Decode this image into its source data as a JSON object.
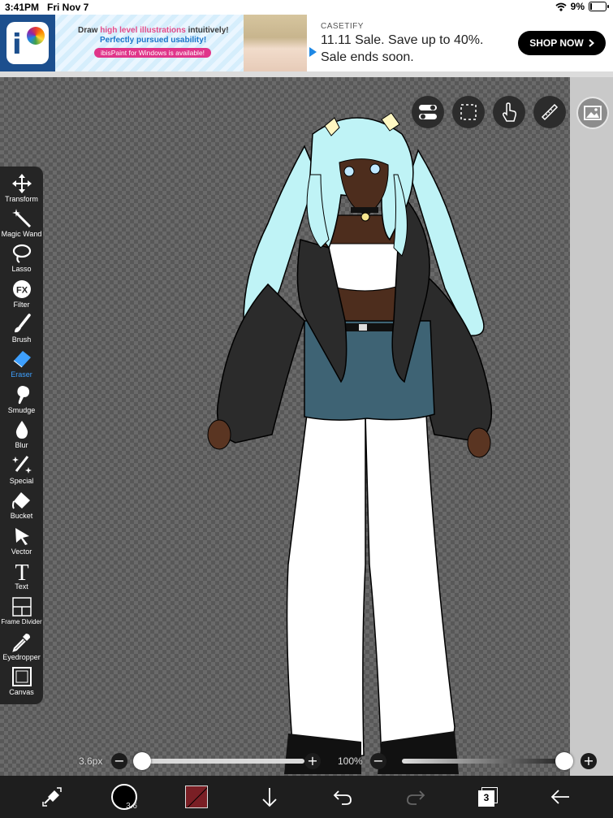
{
  "status_bar": {
    "time": "3:41PM",
    "date": "Fri Nov 7",
    "battery": "9%"
  },
  "ad": {
    "left_banner": {
      "line1_pre": "Draw ",
      "line1_highlight": "high level illustrations",
      "line1_post": " intuitively!",
      "line2": "Perfectly pursued usability!",
      "pill": "ibisPaint for Windows is available!"
    },
    "brand": "CASETIFY",
    "headline_1": "11.11 Sale. Save up to 40%.",
    "headline_2": "Sale ends soon.",
    "cta": "SHOP NOW"
  },
  "tools": [
    {
      "label": "Transform",
      "icon": "move-arrows-icon",
      "active": false
    },
    {
      "label": "Magic Wand",
      "icon": "magic-wand-icon",
      "active": false
    },
    {
      "label": "Lasso",
      "icon": "lasso-icon",
      "active": false
    },
    {
      "label": "Filter",
      "icon": "fx-icon",
      "active": false
    },
    {
      "label": "Brush",
      "icon": "brush-icon",
      "active": false
    },
    {
      "label": "Eraser",
      "icon": "eraser-icon",
      "active": true
    },
    {
      "label": "Smudge",
      "icon": "smudge-icon",
      "active": false
    },
    {
      "label": "Blur",
      "icon": "blur-drop-icon",
      "active": false
    },
    {
      "label": "Special",
      "icon": "special-pen-icon",
      "active": false
    },
    {
      "label": "Bucket",
      "icon": "bucket-icon",
      "active": false
    },
    {
      "label": "Vector",
      "icon": "vector-cursor-icon",
      "active": false
    },
    {
      "label": "Text",
      "icon": "text-t-icon",
      "active": false
    },
    {
      "label": "Frame Divider",
      "icon": "frame-divider-icon",
      "active": false
    },
    {
      "label": "Eyedropper",
      "icon": "eyedropper-icon",
      "active": false
    },
    {
      "label": "Canvas",
      "icon": "canvas-square-icon",
      "active": false
    }
  ],
  "brush_size": {
    "label": "3.6px",
    "min_symbol": "−",
    "max_symbol": "+",
    "level": 0.0
  },
  "opacity": {
    "label": "100%",
    "min_symbol": "−",
    "max_symbol": "+",
    "level": 1.0
  },
  "bottom_bar": {
    "brush_size_badge": "3.6",
    "layer_count": "3",
    "current_color": "#7a1f25"
  },
  "colors": {
    "accent": "#3ea0ff",
    "toolbar": "#252525"
  }
}
